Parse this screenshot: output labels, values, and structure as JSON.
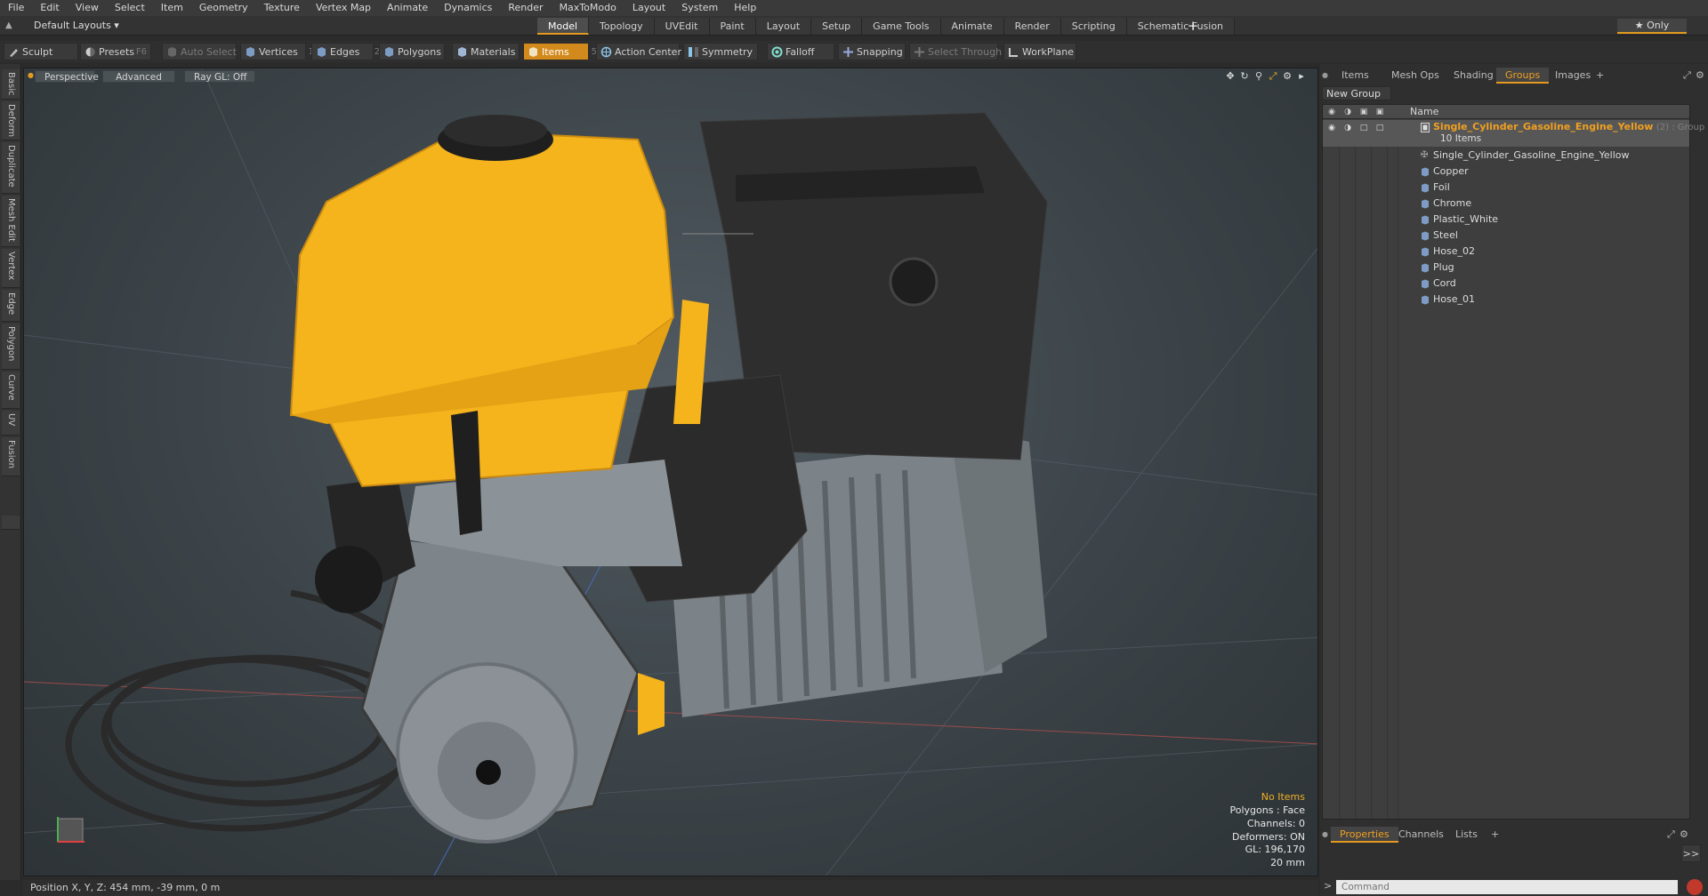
{
  "menu": [
    "File",
    "Edit",
    "View",
    "Select",
    "Item",
    "Geometry",
    "Texture",
    "Vertex Map",
    "Animate",
    "Dynamics",
    "Render",
    "MaxToModo",
    "Layout",
    "System",
    "Help"
  ],
  "layout": {
    "label": "Default Layouts ▾"
  },
  "tabs": [
    {
      "label": "Model",
      "active": true
    },
    {
      "label": "Topology"
    },
    {
      "label": "UVEdit"
    },
    {
      "label": "Paint"
    },
    {
      "label": "Layout"
    },
    {
      "label": "Setup"
    },
    {
      "label": "Game Tools"
    },
    {
      "label": "Animate"
    },
    {
      "label": "Render"
    },
    {
      "label": "Scripting"
    },
    {
      "label": "Schematic Fusion"
    }
  ],
  "add_tab": "+",
  "only_label": "★ Only",
  "toolbar": {
    "sculpt": "Sculpt",
    "presets": "Presets",
    "presets_key": "F6",
    "auto_select": "Auto Select",
    "vertices": "Vertices",
    "vertices_key": "1",
    "edges": "Edges",
    "edges_key": "2",
    "polygons": "Polygons",
    "materials": "Materials",
    "items": "Items",
    "items_key": "5",
    "action_center": "Action Center",
    "symmetry": "Symmetry",
    "falloff": "Falloff",
    "snapping": "Snapping",
    "select_through": "Select Through",
    "workplane": "WorkPlane"
  },
  "left_tabs": [
    "Basic",
    "Deform",
    "Duplicate",
    "Mesh Edit",
    "Vertex",
    "Edge",
    "Polygon",
    "Curve",
    "UV",
    "Fusion"
  ],
  "viewport": {
    "perspective": "Perspective",
    "advanced": "Advanced",
    "raygl": "Ray GL: Off",
    "info": {
      "items": "No Items",
      "polygons": "Polygons : Face",
      "channels": "Channels: 0",
      "deformers": "Deformers: ON",
      "gl": "GL: 196,170",
      "scale": "20 mm"
    }
  },
  "status": {
    "position": "Position X, Y, Z:   454 mm, -39 mm, 0 m"
  },
  "right_tabs": [
    "Items",
    "Mesh Ops",
    "Shading",
    "Groups",
    "Images"
  ],
  "right_tabs_add": "+",
  "new_group": "New Group",
  "tree": {
    "column_name": "Name",
    "group": {
      "name": "Single_Cylinder_Gasoline_Engine_Yellow",
      "tag": "(2) : Group",
      "count": "10 Items"
    },
    "items": [
      {
        "label": "Single_Cylinder_Gasoline_Engine_Yellow",
        "kind": "locator"
      },
      {
        "label": "Copper",
        "kind": "mesh"
      },
      {
        "label": "Foil",
        "kind": "mesh"
      },
      {
        "label": "Chrome",
        "kind": "mesh"
      },
      {
        "label": "Plastic_White",
        "kind": "mesh"
      },
      {
        "label": "Steel",
        "kind": "mesh"
      },
      {
        "label": "Hose_02",
        "kind": "mesh"
      },
      {
        "label": "Plug",
        "kind": "mesh"
      },
      {
        "label": "Cord",
        "kind": "mesh"
      },
      {
        "label": "Hose_01",
        "kind": "mesh"
      }
    ]
  },
  "bottom_tabs": [
    "Properties",
    "Channels",
    "Lists"
  ],
  "bottom_tabs_add": "+",
  "command": {
    "placeholder": "Command"
  },
  "go": ">>",
  "colors": {
    "accent": "#e39a1e",
    "group_text": "#f0a020",
    "tank": "#f5b31c",
    "dark_part": "#2c2c2c",
    "metal": "#8a9094"
  }
}
